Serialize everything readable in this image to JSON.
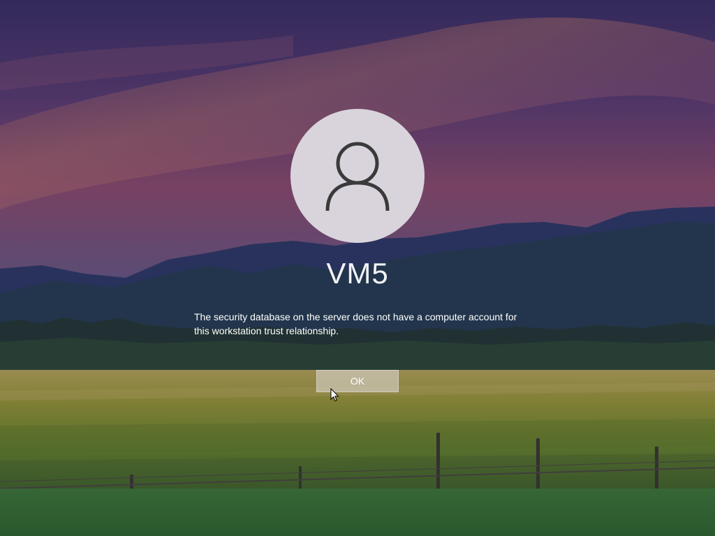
{
  "lock_screen": {
    "username": "VM5",
    "message": "The security database on the server does not have a computer account for this workstation trust relationship.",
    "ok_label": "OK",
    "avatar_icon": "user-icon"
  },
  "colors": {
    "avatar_bg": "#d9d4dc",
    "avatar_stroke": "#3a3a3a",
    "button_bg": "#cdc8b9"
  }
}
